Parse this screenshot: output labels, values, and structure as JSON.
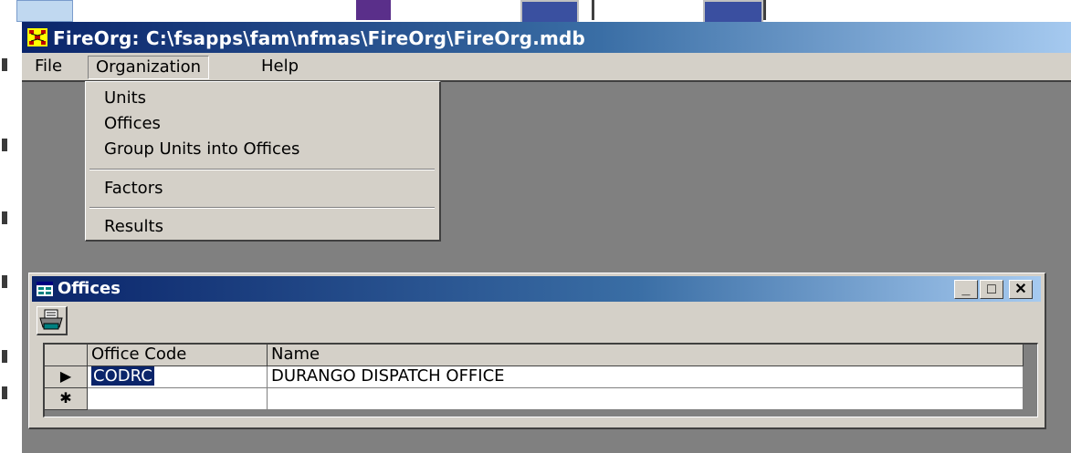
{
  "window": {
    "title": "FireOrg: C:\\fsapps\\fam\\nfmas\\FireOrg\\FireOrg.mdb"
  },
  "menubar": {
    "items": [
      {
        "label": "File"
      },
      {
        "label": "Organization"
      },
      {
        "label": "Help"
      }
    ]
  },
  "organization_menu": {
    "items": [
      {
        "label": "Units"
      },
      {
        "label": "Offices"
      },
      {
        "label": "Group Units into Offices"
      },
      {
        "label": "Factors"
      },
      {
        "label": "Results"
      }
    ]
  },
  "offices_window": {
    "title": "Offices",
    "buttons": {
      "minimize": "_",
      "maximize": "□",
      "close": "✕"
    },
    "toolbar": {
      "print_icon": "printer-icon"
    },
    "grid": {
      "columns": [
        "Office Code",
        "Name"
      ],
      "rows": [
        {
          "indicator": "▶",
          "office_code": "CODRC",
          "name": "DURANGO DISPATCH OFFICE"
        },
        {
          "indicator": "✱",
          "office_code": "",
          "name": ""
        }
      ]
    }
  },
  "colors": {
    "title_active": "#0a246a",
    "face": "#d4d0c8",
    "mdi_background": "#808080",
    "selection": "#0a246a"
  }
}
